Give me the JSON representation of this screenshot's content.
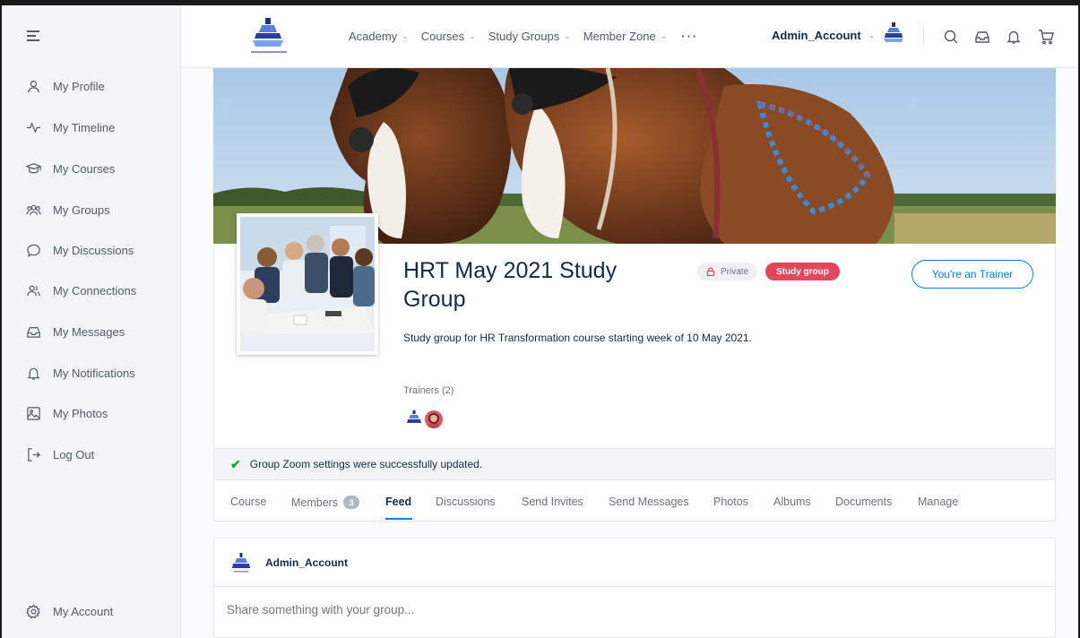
{
  "sidebar": {
    "items": [
      {
        "label": "My Profile",
        "icon": "user-icon"
      },
      {
        "label": "My Timeline",
        "icon": "activity-icon"
      },
      {
        "label": "My Courses",
        "icon": "graduation-cap-icon"
      },
      {
        "label": "My Groups",
        "icon": "groups-icon"
      },
      {
        "label": "My Discussions",
        "icon": "chat-icon"
      },
      {
        "label": "My Connections",
        "icon": "connections-icon"
      },
      {
        "label": "My Messages",
        "icon": "inbox-icon"
      },
      {
        "label": "My Notifications",
        "icon": "bell-icon"
      },
      {
        "label": "My Photos",
        "icon": "image-icon"
      },
      {
        "label": "Log Out",
        "icon": "logout-icon"
      }
    ],
    "account_label": "My Account"
  },
  "header": {
    "nav": [
      {
        "label": "Academy"
      },
      {
        "label": "Courses"
      },
      {
        "label": "Study Groups"
      },
      {
        "label": "Member Zone"
      }
    ],
    "more": "···",
    "account_name": "Admin_Account"
  },
  "group": {
    "title": "HRT May 2021 Study Group",
    "privacy_badge": "Private",
    "type_badge": "Study group",
    "role_button": "You're an Trainer",
    "description": "Study group for HR Transformation course starting week of  10 May 2021.",
    "trainers_label": "Trainers (2)"
  },
  "notice": "Group Zoom settings were successfully updated.",
  "tabs": [
    {
      "label": "Course"
    },
    {
      "label": "Members",
      "count": "3"
    },
    {
      "label": "Feed"
    },
    {
      "label": "Discussions"
    },
    {
      "label": "Send Invites"
    },
    {
      "label": "Send Messages"
    },
    {
      "label": "Photos"
    },
    {
      "label": "Albums"
    },
    {
      "label": "Documents"
    },
    {
      "label": "Manage"
    }
  ],
  "active_tab": "Feed",
  "composer": {
    "author": "Admin_Account",
    "placeholder": "Share something with your group..."
  },
  "colors": {
    "accent": "#007cff",
    "study_badge": "#e3485a",
    "success": "#1aa53a"
  }
}
